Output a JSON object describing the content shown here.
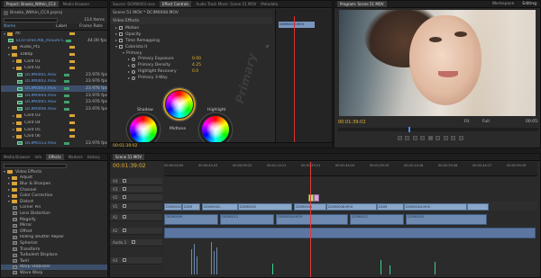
{
  "app": {
    "workspace_label": "Workspace",
    "workspace_value": "Editing"
  },
  "project": {
    "tab": "Project: Brooks_Within_CC4",
    "tab2": "Media Browser",
    "filename": "Brooks_Within_CC4.prproj",
    "item_count": "114 Items",
    "columns": {
      "name": "Name",
      "label": "Label",
      "framerate": "Frame Rate"
    },
    "rows": [
      {
        "name": "All",
        "rate": "",
        "kind": "folder",
        "indent": 0,
        "open": true
      },
      {
        "name": "ECO-Ores-Alb_mixure-C...",
        "rate": "44.00 fps",
        "kind": "clip",
        "indent": 1,
        "open": false
      },
      {
        "name": "Audio_Pt1",
        "rate": "",
        "kind": "folder",
        "indent": 1,
        "open": false
      },
      {
        "name": "1080p",
        "rate": "",
        "kind": "folder",
        "indent": 1,
        "open": true
      },
      {
        "name": "Card 01",
        "rate": "",
        "kind": "folder",
        "indent": 2,
        "open": false
      },
      {
        "name": "Card 02",
        "rate": "",
        "kind": "folder",
        "indent": 2,
        "open": true
      },
      {
        "name": "DCIM0001.mov",
        "rate": "23.976 fps",
        "kind": "clip",
        "indent": 3,
        "open": false
      },
      {
        "name": "DCIM0002.mov",
        "rate": "23.976 fps",
        "kind": "clip",
        "indent": 3,
        "open": false
      },
      {
        "name": "DCIM0003.mov",
        "rate": "23.976 fps",
        "kind": "clip",
        "indent": 3,
        "open": false
      },
      {
        "name": "DCIM0004.mov",
        "rate": "23.976 fps",
        "kind": "clip",
        "indent": 3,
        "open": false
      },
      {
        "name": "DCIM0005.mov",
        "rate": "23.976 fps",
        "kind": "clip",
        "indent": 3,
        "open": false
      },
      {
        "name": "DCIM0006.mov",
        "rate": "23.976 fps",
        "kind": "clip",
        "indent": 3,
        "open": false
      },
      {
        "name": "Card 03",
        "rate": "",
        "kind": "folder",
        "indent": 2,
        "open": false
      },
      {
        "name": "Card 04",
        "rate": "",
        "kind": "folder",
        "indent": 2,
        "open": false
      },
      {
        "name": "Card 05",
        "rate": "",
        "kind": "folder",
        "indent": 2,
        "open": false
      },
      {
        "name": "Card 06",
        "rate": "",
        "kind": "folder",
        "indent": 2,
        "open": false
      },
      {
        "name": "DCIM0113.mov",
        "rate": "23.976 fps",
        "kind": "clip",
        "indent": 3,
        "open": false
      }
    ]
  },
  "effect_controls": {
    "tabs": [
      "Source: DCIM0003.mov",
      "Effect Controls",
      "Audio Track Mixer: Scene 51 MOV",
      "Metadata"
    ],
    "breadcrumb": "Scene 51 MOV * DCIM0008.MOV",
    "clip_label": "DKIM0008.MOV",
    "section": "Video Effects",
    "items": [
      "Motion",
      "Opacity",
      "Time Remapping",
      "Colorista II"
    ],
    "primary_label": "Primary",
    "params": [
      {
        "name": "Primary Exposure",
        "value": "0.00"
      },
      {
        "name": "Primary Density",
        "value": "4.25"
      },
      {
        "name": "Highlight Recovery",
        "value": "0.0"
      },
      {
        "name": "Primary 3-Way",
        "value": ""
      }
    ],
    "wheels": {
      "shadow": "Shadow",
      "midtone": "Midtone",
      "highlight": "Highlight"
    },
    "watermark": "Primary",
    "timecode": "00:01:39:02"
  },
  "program": {
    "tab": "Program: Scene 51 MOV",
    "timecode_left": "00:01:39:02",
    "fit": "Fit",
    "quality": "Full",
    "timecode_right": "00:05:"
  },
  "effects": {
    "tabs": [
      "Media Browser",
      "Info",
      "Effects",
      "Markers",
      "History"
    ],
    "items": [
      {
        "name": "Video Effects",
        "level": 0
      },
      {
        "name": "Adjust",
        "level": 1
      },
      {
        "name": "Blur & Sharpen",
        "level": 1
      },
      {
        "name": "Channel",
        "level": 1
      },
      {
        "name": "Color Correction",
        "level": 1
      },
      {
        "name": "Distort",
        "level": 1
      },
      {
        "name": "Corner Pin",
        "level": 2
      },
      {
        "name": "Lens Distortion",
        "level": 2
      },
      {
        "name": "Magnify",
        "level": 2
      },
      {
        "name": "Mirror",
        "level": 2
      },
      {
        "name": "Offset",
        "level": 2
      },
      {
        "name": "Rolling Shutter Repair",
        "level": 2
      },
      {
        "name": "Spherize",
        "level": 2
      },
      {
        "name": "Transform",
        "level": 2
      },
      {
        "name": "Turbulent Displace",
        "level": 2
      },
      {
        "name": "Twirl",
        "level": 2
      },
      {
        "name": "Warp Stabilizer",
        "level": 2
      },
      {
        "name": "Wave Warp",
        "level": 2
      }
    ]
  },
  "timeline": {
    "tab": "Scene 51 MOV",
    "timecode": "00:01:39:02",
    "ruler": [
      "00:00:00:00",
      "00:00:44:23",
      "00:00:59:22",
      "00:01:14:21",
      "00:01:29:21",
      "00:01:44:20",
      "00:01:59:19",
      "00:02:14:18",
      "00:02:29:18",
      "00:02:44:17",
      "00:02:59:16"
    ],
    "tracks": [
      "V4",
      "V3",
      "V2",
      "V1",
      "A1",
      "A2",
      "Audio 2",
      "A3"
    ],
    "v1_clips": [
      "DCIM0001",
      "DCIM",
      "DCIM0002.",
      "DCIM0003",
      "DCIM0005",
      "DCIM0008.MOV",
      "DCIM",
      "DCIM0004.MOV"
    ],
    "a1_labels": [
      "DCIM0009",
      "DCIM0012",
      "DCIM0004.MOV",
      "DCIM0011",
      "DCIM0010"
    ]
  }
}
